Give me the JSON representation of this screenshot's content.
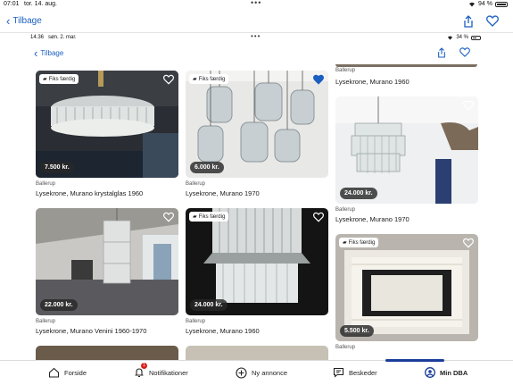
{
  "device_status": {
    "time": "07:01",
    "date": "tor. 14. aug.",
    "battery": "94 %"
  },
  "outer_nav": {
    "back_label": "Tilbage"
  },
  "inner_status": {
    "time": "14.36",
    "date": "søn. 2. mar.",
    "battery": "34 %"
  },
  "inner_nav": {
    "back_label": "Tilbage"
  },
  "top_partial": {
    "location": "Ballerup",
    "title": "Lysekrone, Murano 1960"
  },
  "listings": [
    {
      "location": "Ballerup",
      "title": "Lysekrone, Murano krystalglas 1960",
      "price": "7.500 kr.",
      "badge": "Fiks færdig",
      "favorited": false
    },
    {
      "location": "Ballerup",
      "title": "Lysekrone, Murano 1970",
      "price": "6.000 kr.",
      "badge": "Fiks færdig",
      "favorited": true
    },
    {
      "location": "Ballerup",
      "title": "Lysekrone, Murano 1970",
      "price": "24.000 kr.",
      "badge": "",
      "favorited": false
    },
    {
      "location": "Ballerup",
      "title": "Lysekrone, Murano Venini 1960-1970",
      "price": "22.000 kr.",
      "badge": "",
      "favorited": false
    },
    {
      "location": "Ballerup",
      "title": "Lysekrone, Murano 1960",
      "price": "24.000 kr.",
      "badge": "Fiks færdig",
      "favorited": false
    },
    {
      "location": "Ballerup",
      "title": "",
      "price": "5.500 kr.",
      "badge": "Fiks færdig",
      "favorited": false
    }
  ],
  "tabbar": {
    "items": [
      {
        "label": "Forside",
        "icon": "home-icon"
      },
      {
        "label": "Notifikationer",
        "icon": "bell-icon",
        "count": "1"
      },
      {
        "label": "Ny annonce",
        "icon": "plus-circle-icon"
      },
      {
        "label": "Beskeder",
        "icon": "chat-icon"
      },
      {
        "label": "Min DBA",
        "icon": "profile-icon",
        "active": true
      }
    ]
  },
  "colors": {
    "accent": "#1b5fc1",
    "active_tab": "#1b3d9a",
    "badge_red": "#d9211c"
  }
}
